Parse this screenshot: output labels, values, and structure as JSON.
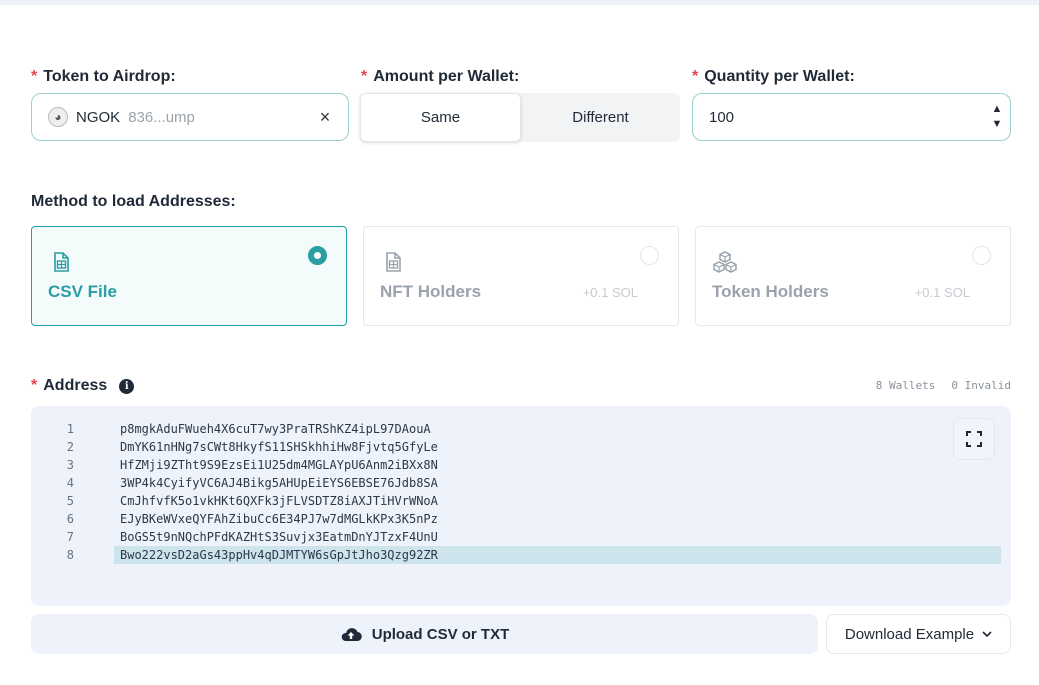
{
  "token": {
    "label": "Token to Airdrop:",
    "required_mark": "*",
    "symbol": "NGOK",
    "address_short": "836...ump",
    "clear_glyph": "×",
    "avatar_icon": "token-avatar-icon"
  },
  "amount": {
    "label": "Amount per Wallet:",
    "required_mark": "*",
    "options": [
      "Same",
      "Different"
    ],
    "selected": "Same"
  },
  "quantity": {
    "label": "Quantity per Wallet:",
    "required_mark": "*",
    "value": "100",
    "up_glyph": "▲",
    "down_glyph": "▼"
  },
  "method": {
    "label": "Method to load Addresses:",
    "cards": [
      {
        "title": "CSV File",
        "price": "",
        "icon": "file-spreadsheet-icon",
        "selected": true
      },
      {
        "title": "NFT Holders",
        "price": "+0.1 SOL",
        "icon": "file-spreadsheet-icon",
        "selected": false
      },
      {
        "title": "Token Holders",
        "price": "+0.1 SOL",
        "icon": "cubes-icon",
        "selected": false
      }
    ]
  },
  "address": {
    "label": "Address",
    "required_mark": "*",
    "info_glyph": "i",
    "wallets_count": "8 Wallets",
    "invalid_count": "0 Invalid",
    "lines": [
      {
        "no": "1",
        "text": "p8mgkAduFWueh4X6cuT7wy3PraTRShKZ4ipL97DAouA"
      },
      {
        "no": "2",
        "text": "DmYK61nHNg7sCWt8HkyfS11SHSkhhiHw8Fjvtq5GfyLe"
      },
      {
        "no": "3",
        "text": "HfZMji9ZTht9S9EzsEi1U25dm4MGLAYpU6Anm2iBXx8N"
      },
      {
        "no": "4",
        "text": "3WP4k4CyifyVC6AJ4Bikg5AHUpEiEYS6EBSE76Jdb8SA"
      },
      {
        "no": "5",
        "text": "CmJhfvfK5o1vkHKt6QXFk3jFLVSDTZ8iAXJTiHVrWNoA"
      },
      {
        "no": "6",
        "text": "EJyBKeWVxeQYFAhZibuCc6E34PJ7w7dMGLkKPx3K5nPz"
      },
      {
        "no": "7",
        "text": "BoGS5t9nNQchPFdKAZHtS3Suvjx3EatmDnYJTzxF4UnU"
      },
      {
        "no": "8",
        "text": "Bwo222vsD2aGs43ppHv4qDJMTYW6sGpJtJho3Qzg92ZR"
      }
    ],
    "highlighted_line": "8"
  },
  "actions": {
    "upload_label": "Upload CSV or TXT",
    "download_label": "Download Example"
  },
  "colors": {
    "accent": "#2a9ea3",
    "required": "#e5484d",
    "editor_bg": "#eef3fb",
    "highlight_line": "#cde4ec"
  }
}
